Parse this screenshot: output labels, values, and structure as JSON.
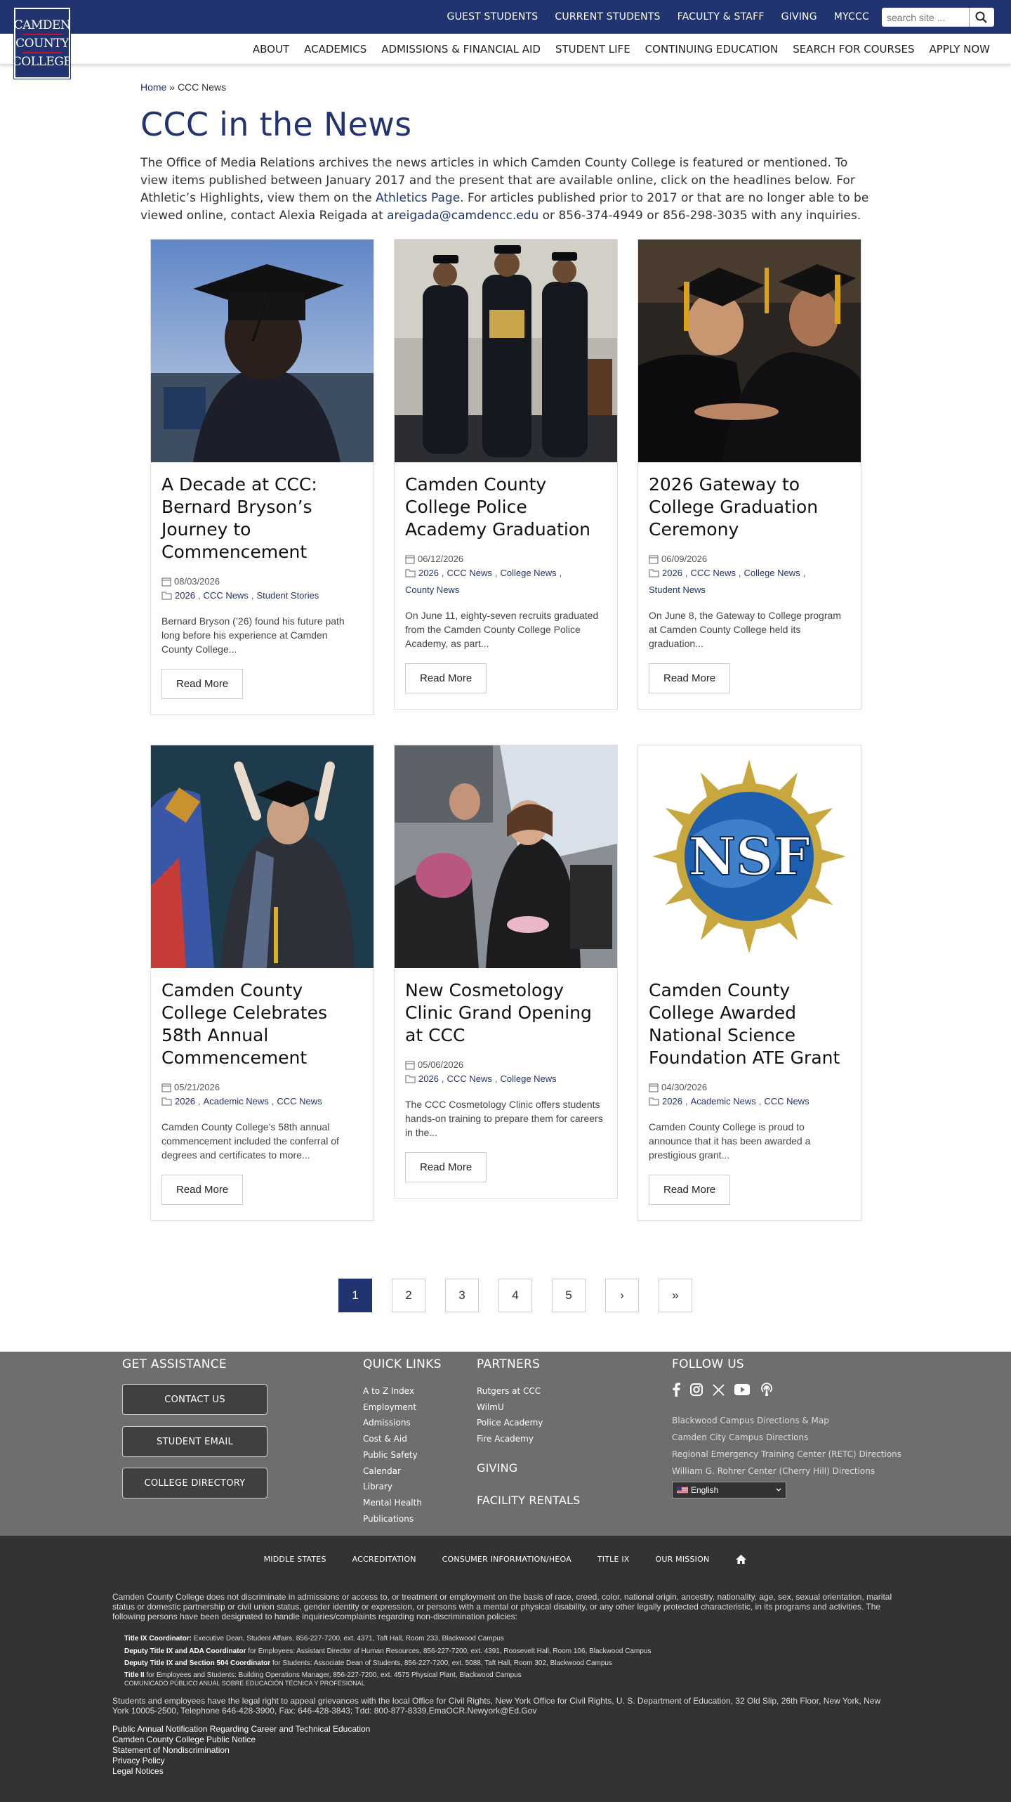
{
  "logo": {
    "line1": "CAMDEN",
    "line2": "COUNTY",
    "line3": "COLLEGE"
  },
  "utility_nav": [
    "GUEST STUDENTS",
    "CURRENT STUDENTS",
    "FACULTY & STAFF",
    "GIVING",
    "MYCCC"
  ],
  "search": {
    "placeholder": "search site ..."
  },
  "main_nav": [
    "ABOUT",
    "ACADEMICS",
    "ADMISSIONS & FINANCIAL AID",
    "STUDENT LIFE",
    "CONTINUING EDUCATION",
    "SEARCH FOR COURSES",
    "APPLY NOW"
  ],
  "breadcrumb": {
    "home": "Home",
    "sep": " » ",
    "current": "CCC News"
  },
  "page_title": "CCC in the News",
  "intro": {
    "part1": "The Office of Media Relations archives the news articles in which Camden County College is featured or mentioned. To view items published between January 2017 and the present that are available online, click on the headlines below. For Athletic’s Highlights, view them on the ",
    "link1": "Athletics Page",
    "part2": ". For articles published prior to 2017 or that are no longer able to be viewed online, contact Alexia Reigada at ",
    "email": "areigada@camdencc.edu",
    "part3": " or 856-374-4949 or 856-298-3035 with any inquiries."
  },
  "read_more": "Read More",
  "articles": [
    {
      "title": "A Decade at CCC: Bernard Bryson’s Journey to Commencement",
      "date": "08/03/2026",
      "cats": [
        "2026",
        "CCC News",
        "Student Stories"
      ],
      "excerpt": "Bernard Bryson (’26) found his future path long before his experience at Camden County College..."
    },
    {
      "title": "Camden County College Police Academy Graduation",
      "date": "06/12/2026",
      "cats": [
        "2026",
        "CCC News",
        "College News",
        "County News"
      ],
      "excerpt": "On June 11, eighty-seven recruits graduated from the Camden County College Police Academy, as part..."
    },
    {
      "title": "2026 Gateway to College Graduation Ceremony",
      "date": "06/09/2026",
      "cats": [
        "2026",
        "CCC News",
        "College News",
        "Student News"
      ],
      "excerpt": "On June 8, the Gateway to College program at Camden County College held its graduation..."
    },
    {
      "title": "Camden County College Celebrates 58th Annual Commencement",
      "date": "05/21/2026",
      "cats": [
        "2026",
        "Academic News",
        "CCC News"
      ],
      "excerpt": "Camden County College’s 58th annual commencement included the conferral of degrees and certificates to more..."
    },
    {
      "title": "New Cosmetology Clinic Grand Opening at CCC",
      "date": "05/06/2026",
      "cats": [
        "2026",
        "CCC News",
        "College News"
      ],
      "excerpt": "The CCC Cosmetology Clinic offers students hands-on training to prepare them for careers in the..."
    },
    {
      "title": "Camden County College Awarded National Science Foundation ATE Grant",
      "date": "04/30/2026",
      "cats": [
        "2026",
        "Academic News",
        "CCC News"
      ],
      "excerpt": "Camden County College is proud to announce that it has been awarded a prestigious grant..."
    }
  ],
  "nsf_text": "NSF",
  "pagination": [
    "1",
    "2",
    "3",
    "4",
    "5",
    "›",
    "»"
  ],
  "footer": {
    "get_assistance": "GET ASSISTANCE",
    "buttons": [
      "CONTACT US",
      "STUDENT EMAIL",
      "COLLEGE DIRECTORY"
    ],
    "quick_links_title": "QUICK LINKS",
    "quick_links": [
      "A to Z Index",
      "Employment",
      "Admissions",
      "Cost & Aid",
      "Public Safety",
      "Calendar",
      "Library",
      "Mental Health",
      "Publications"
    ],
    "partners_title": "PARTNERS",
    "partners": [
      "Rutgers at CCC",
      "WilmU",
      "Police Academy",
      "Fire Academy"
    ],
    "giving": "GIVING",
    "facility": "FACILITY RENTALS",
    "follow_title": "FOLLOW US",
    "directions": [
      "Blackwood Campus Directions & Map",
      "Camden City Campus Directions",
      "Regional Emergency Training Center (RETC) Directions",
      "William G. Rohrer Center (Cherry Hill) Directions"
    ],
    "language": "English",
    "legal_nav": [
      "MIDDLE STATES",
      "ACCREDITATION",
      "CONSUMER INFORMATION/HEOA",
      "TITLE IX",
      "OUR MISSION"
    ],
    "nondiscrimination": "Camden County College does not discriminate in admissions or access to, or treatment or employment on the basis of race, creed, color, national origin, ancestry, nationality, age, sex, sexual orientation, marital status or domestic partnership or civil union status, gender identity or expression, or persons with a mental or physical disability, or any other legally protected characteristic, in its programs and activities. The following persons have been designated to handle inquiries/complaints regarding non-discrimination policies:",
    "coordinators": [
      {
        "role": "Title IX Coordinator:",
        "detail": " Executive Dean, Student Affairs, 856-227-7200, ext. 4371, Taft Hall, Room 233, Blackwood Campus"
      },
      {
        "role": "Deputy Title IX and ADA Coordinator",
        "detail": " for Employees: Assistant Director of Human Resources, 856-227-7200, ext. 4391, Roosevelt Hall, Room 106, Blackwood Campus"
      },
      {
        "role": "Deputy Title IX and Section 504 Coordinator",
        "detail": " for Students: Associate Dean of Students, 856-227-7200, ext. 5088, Taft Hall, Room 302, Blackwood Campus"
      },
      {
        "role": "Title II",
        "detail": " for Employees and Students: Building Operations Manager, 856-227-7200, ext. 4575 Physical Plant, Blackwood Campus"
      }
    ],
    "comunicado": "COMUNICADO PÚBLICO ANUAL SOBRE EDUCACIÓN TÉCNICA Y PROFESIONAL",
    "rights": "Students and employees have the legal right to appeal grievances with the local Office for Civil Rights, New York Office for Civil Rights, U. S. Department of Education, 32 Old Slip, 26th Floor, New York, New York 10005-2500, Telephone 646-428-3900, Fax: 646-428-3843; Tdd: 800-877-8339,EmaOCR.Newyork@Ed.Gov",
    "bottom_links": [
      "Public Annual Notification Regarding Career and Technical Education",
      "Camden County College Public Notice",
      "Statement of Nondiscrimination",
      "Privacy Policy",
      "Legal Notices"
    ]
  },
  "colors": {
    "brand": "#21346f",
    "footer_top": "#6e6e6e",
    "footer_bottom": "#333333"
  }
}
